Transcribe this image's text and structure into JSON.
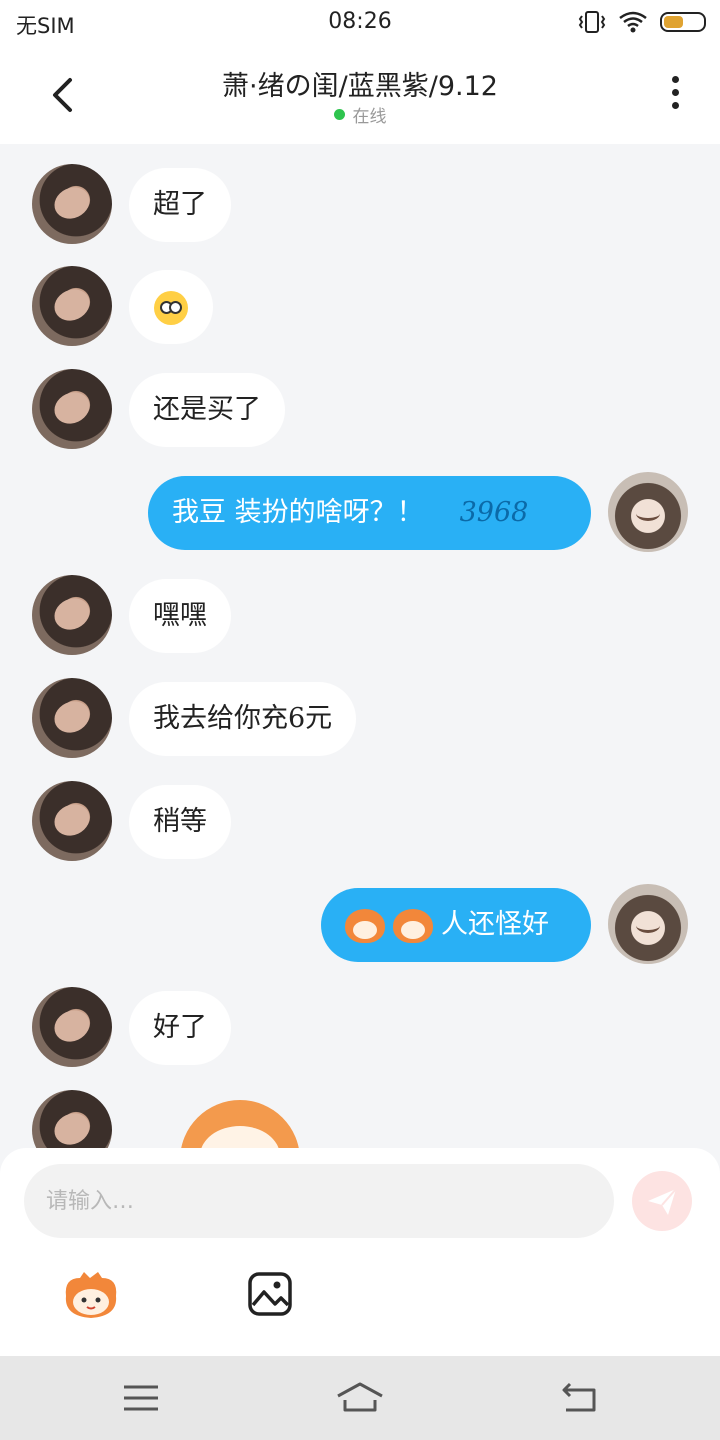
{
  "status_bar": {
    "carrier": "无SIM",
    "time": "08:26",
    "battery_level": 0.5,
    "icons": [
      "vibrate-icon",
      "wifi-icon",
      "battery-icon"
    ]
  },
  "header": {
    "title": "萧·绪の闺/蓝黑紫/9.12",
    "status": "在线",
    "status_color": "#2ec44e",
    "back_icon": "chevron-left-icon",
    "more_icon": "more-vertical-icon"
  },
  "messages": [
    {
      "side": "in",
      "text": "超了"
    },
    {
      "side": "in",
      "text": "",
      "emoji": "flushed-face-emoji"
    },
    {
      "side": "in",
      "text": "还是买了"
    },
    {
      "side": "out",
      "text": "我豆 装扮的啥呀？！",
      "number": "3968"
    },
    {
      "side": "in",
      "text": "嘿嘿"
    },
    {
      "side": "in",
      "text": "我去给你充6元"
    },
    {
      "side": "in",
      "text": "稍等"
    },
    {
      "side": "out",
      "text": "人还怪好",
      "stickers": [
        "tiger-sticker",
        "tiger-sticker"
      ]
    },
    {
      "side": "in",
      "text": "好了"
    },
    {
      "side": "in",
      "text": "",
      "sticker": "orange-cat-sticker"
    }
  ],
  "input": {
    "placeholder": "请输入…",
    "send_icon": "paper-plane-icon",
    "send_color": "#fde3e2",
    "tools": [
      "sticker-icon",
      "image-icon"
    ]
  },
  "bubble_colors": {
    "outgoing": "#29b0f5",
    "incoming": "#ffffff"
  },
  "nav_bar": {
    "icons": [
      "menu-icon",
      "home-icon",
      "back-icon"
    ]
  }
}
